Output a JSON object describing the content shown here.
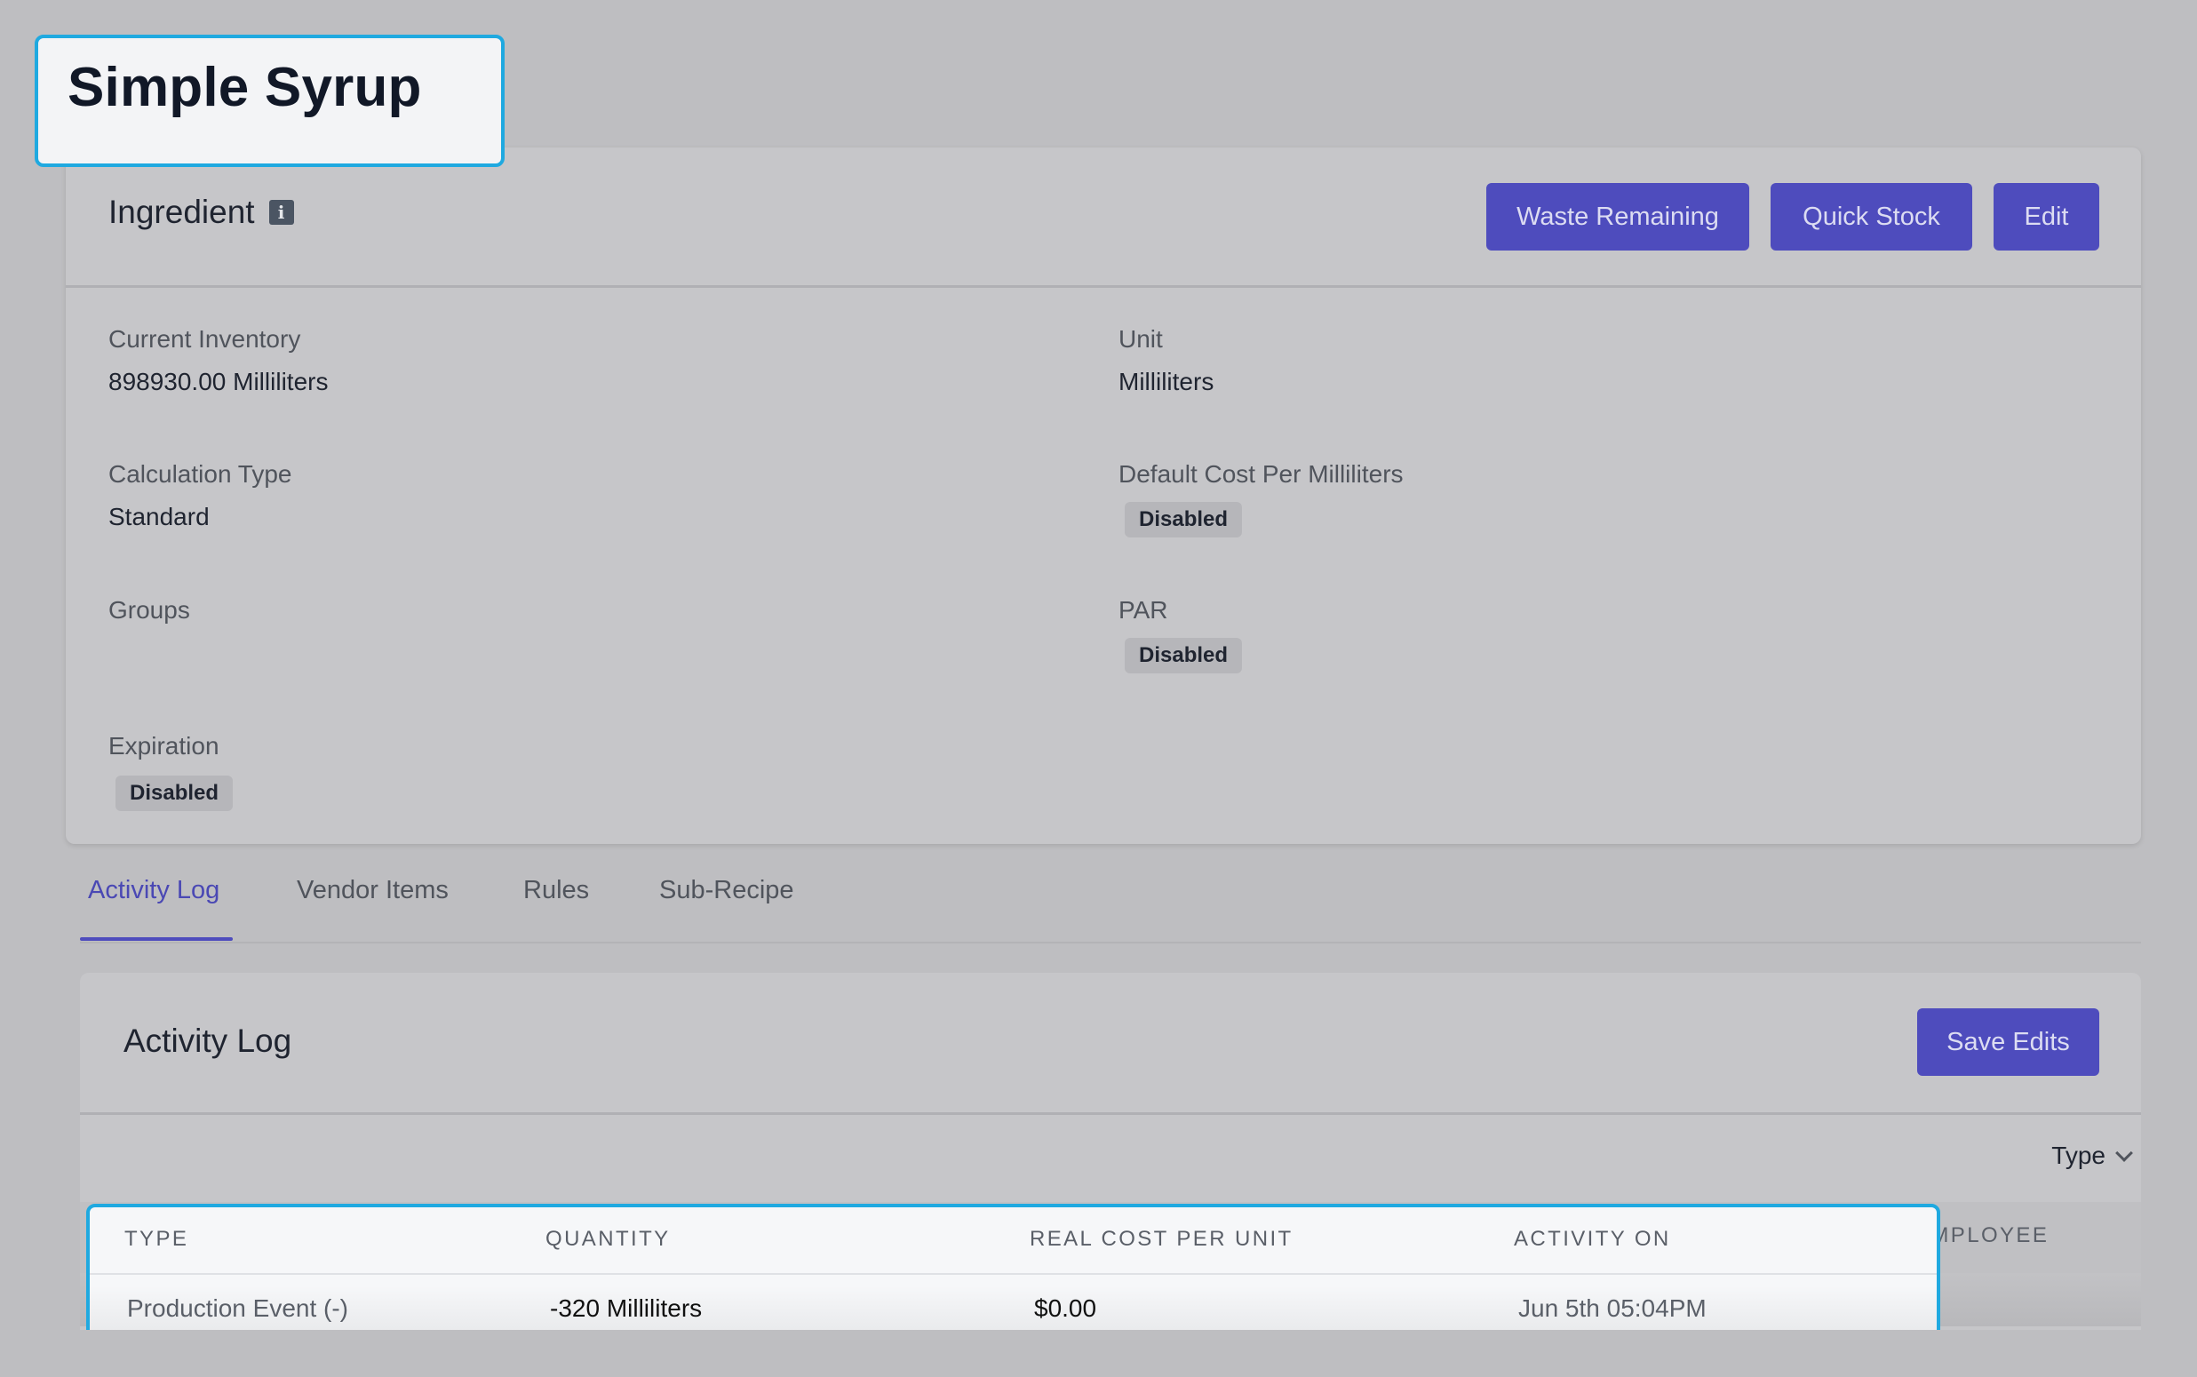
{
  "page": {
    "title": "Simple Syrup"
  },
  "ingredient": {
    "heading": "Ingredient",
    "info_icon": "i",
    "buttons": {
      "waste_remaining": "Waste Remaining",
      "quick_stock": "Quick Stock",
      "edit": "Edit"
    },
    "fields": {
      "current_inventory_label": "Current Inventory",
      "current_inventory_value": "898930.00 Milliliters",
      "unit_label": "Unit",
      "unit_value": "Milliliters",
      "calculation_type_label": "Calculation Type",
      "calculation_type_value": "Standard",
      "default_cost_label": "Default Cost Per Milliliters",
      "default_cost_value": "Disabled",
      "groups_label": "Groups",
      "par_label": "PAR",
      "par_value": "Disabled",
      "expiration_label": "Expiration",
      "expiration_value": "Disabled"
    }
  },
  "tabs": [
    {
      "label": "Activity Log",
      "active": true
    },
    {
      "label": "Vendor Items",
      "active": false
    },
    {
      "label": "Rules",
      "active": false
    },
    {
      "label": "Sub-Recipe",
      "active": false
    }
  ],
  "activity_log": {
    "title": "Activity Log",
    "save_button": "Save Edits",
    "filter_label": "Type",
    "columns": [
      "TYPE",
      "QUANTITY",
      "REAL COST PER UNIT",
      "ACTIVITY ON",
      "EMPLOYEE"
    ],
    "rows": [
      {
        "type": "Production Event (-)",
        "quantity": "-320 Milliliters",
        "real_cost_per_unit": "$0.00",
        "activity_on": "Jun 5th 05:04PM"
      }
    ]
  },
  "colors": {
    "accent": "#4e4cbd",
    "highlight_border": "#1fa9e0"
  }
}
